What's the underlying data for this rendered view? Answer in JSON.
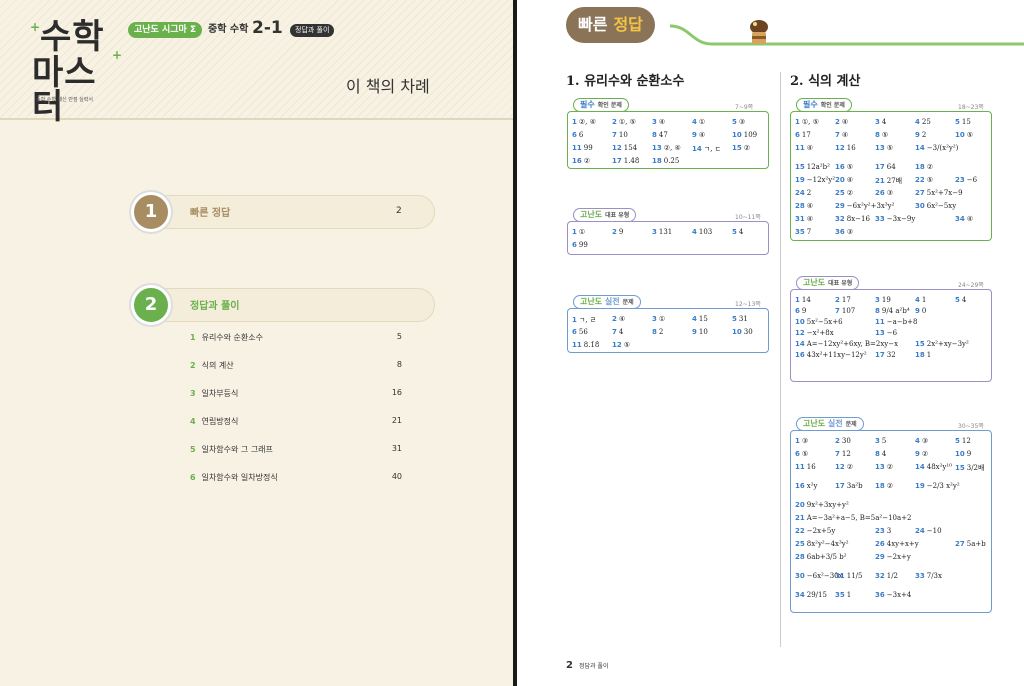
{
  "logo": {
    "line1": "수학",
    "line2": "마스터",
    "sub": "중학 수학 내신 만점 실력서"
  },
  "header": {
    "badge": "고난도 시그마 Σ",
    "subject": "중학 수학",
    "grade": "2-1",
    "tag": "정답과 풀이"
  },
  "toc": {
    "title": "이 책의 차례",
    "sections": [
      {
        "num": "1",
        "label": "빠른 정답",
        "page": "2",
        "color": "#a88c62"
      },
      {
        "num": "2",
        "label": "정답과 풀이",
        "page": "",
        "color": "#6ab04c"
      }
    ],
    "items": [
      {
        "n": "1",
        "t": "유리수와 순환소수",
        "p": "5"
      },
      {
        "n": "2",
        "t": "식의 계산",
        "p": "8"
      },
      {
        "n": "3",
        "t": "일차부등식",
        "p": "16"
      },
      {
        "n": "4",
        "t": "연립방정식",
        "p": "21"
      },
      {
        "n": "5",
        "t": "일차함수와 그 그래프",
        "p": "31"
      },
      {
        "n": "6",
        "t": "일차함수와 일차방정식",
        "p": "40"
      }
    ]
  },
  "quick": {
    "title1": "빠른",
    "title2": "정답"
  },
  "chapters": {
    "c1": "1. 유리수와 순환소수",
    "c2": "2. 식의 계산"
  },
  "footer": {
    "page": "2",
    "text": "정답과 풀이"
  },
  "boxes": [
    {
      "id": "b1",
      "label_a": "필수",
      "label_b": "",
      "label_c": "확인 문제",
      "range": "7~9쪽",
      "answers": [
        [
          "1",
          "②, ④"
        ],
        [
          "2",
          "①, ⑤"
        ],
        [
          "3",
          "④"
        ],
        [
          "4",
          "①"
        ],
        [
          "5",
          "③"
        ],
        [
          "6",
          "6"
        ],
        [
          "7",
          "10"
        ],
        [
          "8",
          "47"
        ],
        [
          "9",
          "④"
        ],
        [
          "10",
          "109"
        ],
        [
          "11",
          "99"
        ],
        [
          "12",
          "154"
        ],
        [
          "13",
          "②, ④"
        ],
        [
          "14",
          "ㄱ, ㄷ"
        ],
        [
          "15",
          "②"
        ],
        [
          "16",
          "②"
        ],
        [
          "17",
          "1.4̇8̇"
        ],
        [
          "18",
          "0.2̇5̇"
        ]
      ]
    },
    {
      "id": "b2",
      "label_a": "고난도",
      "label_b": "",
      "label_c": "대표 유형",
      "range": "10~11쪽",
      "answers": [
        [
          "1",
          "①"
        ],
        [
          "2",
          "9"
        ],
        [
          "3",
          "131"
        ],
        [
          "4",
          "103"
        ],
        [
          "5",
          "4"
        ],
        [
          "6",
          "99"
        ]
      ]
    },
    {
      "id": "b3",
      "label_a": "고난도",
      "label_b": "실전",
      "label_c": "문제",
      "range": "12~13쪽",
      "answers": [
        [
          "1",
          "ㄱ, ㄹ"
        ],
        [
          "2",
          "④"
        ],
        [
          "3",
          "①"
        ],
        [
          "4",
          "15"
        ],
        [
          "5",
          "31"
        ],
        [
          "6",
          "56"
        ],
        [
          "7",
          "4"
        ],
        [
          "8",
          "2"
        ],
        [
          "9",
          "10"
        ],
        [
          "10",
          "30"
        ],
        [
          "11",
          "8.1̇8̇"
        ],
        [
          "12",
          "⑤"
        ]
      ]
    },
    {
      "id": "b4",
      "label_a": "필수",
      "label_b": "",
      "label_c": "확인 문제",
      "range": "18~23쪽",
      "answers": [
        [
          "1",
          "①, ⑤"
        ],
        [
          "2",
          "④"
        ],
        [
          "3",
          "4"
        ],
        [
          "4",
          "25"
        ],
        [
          "5",
          "15"
        ],
        [
          "6",
          "17"
        ],
        [
          "7",
          "④"
        ],
        [
          "8",
          "⑤"
        ],
        [
          "9",
          "2"
        ],
        [
          "10",
          "⑤"
        ],
        [
          "11",
          "④"
        ],
        [
          "12",
          "16"
        ],
        [
          "13",
          "⑤"
        ],
        [
          "14",
          "−3/(x²y²)"
        ],
        [
          "15",
          "12a²b²"
        ],
        [
          "16",
          "⑤"
        ],
        [
          "17",
          "64"
        ],
        [
          "18",
          "②"
        ],
        [
          "19",
          "−12x²y²"
        ],
        [
          "20",
          "④"
        ],
        [
          "21",
          "27배"
        ],
        [
          "22",
          "⑤"
        ],
        [
          "23",
          "−6"
        ],
        [
          "24",
          "2"
        ],
        [
          "25",
          "②"
        ],
        [
          "26",
          "③"
        ],
        [
          "27",
          "5x²+7x−9"
        ],
        [
          "28",
          "④"
        ],
        [
          "29",
          "−6x²y²+3x³y²"
        ],
        [
          "30",
          "6x²−5xy"
        ],
        [
          "31",
          "④"
        ],
        [
          "32",
          "8x−16"
        ],
        [
          "33",
          "−3x−9y"
        ],
        [
          "34",
          "④"
        ],
        [
          "35",
          "7"
        ],
        [
          "36",
          "③"
        ]
      ]
    },
    {
      "id": "b5",
      "label_a": "고난도",
      "label_b": "",
      "label_c": "대표 유형",
      "range": "24~29쪽",
      "answers": [
        [
          "1",
          "14"
        ],
        [
          "2",
          "17"
        ],
        [
          "3",
          "19"
        ],
        [
          "4",
          "1"
        ],
        [
          "5",
          "4"
        ],
        [
          "6",
          "9"
        ],
        [
          "7",
          "107"
        ],
        [
          "8",
          "9/4 a²b⁴"
        ],
        [
          "9",
          "0"
        ],
        [
          "10",
          "5x²−5x+6"
        ],
        [
          "11",
          "−a−b+8"
        ],
        [
          "12",
          "−x²+8x"
        ],
        [
          "13",
          "−6"
        ],
        [
          "14",
          "A=−12xy²+6xy, B=2xy−x"
        ],
        [
          "15",
          "2x²+xy−3y²"
        ],
        [
          "16",
          "43x²+11xy−12y²"
        ],
        [
          "17",
          "32"
        ],
        [
          "18",
          "1"
        ]
      ]
    },
    {
      "id": "b6",
      "label_a": "고난도",
      "label_b": "실전",
      "label_c": "문제",
      "range": "30~35쪽",
      "answers": [
        [
          "1",
          "③"
        ],
        [
          "2",
          "30"
        ],
        [
          "3",
          "5"
        ],
        [
          "4",
          "③"
        ],
        [
          "5",
          "12"
        ],
        [
          "6",
          "⑤"
        ],
        [
          "7",
          "12"
        ],
        [
          "8",
          "4"
        ],
        [
          "9",
          "②"
        ],
        [
          "10",
          "9"
        ],
        [
          "11",
          "16"
        ],
        [
          "12",
          "②"
        ],
        [
          "13",
          "②"
        ],
        [
          "14",
          "48x²y¹⁰"
        ],
        [
          "15",
          "3/2배"
        ],
        [
          "16",
          "x²y"
        ],
        [
          "17",
          "3a²b"
        ],
        [
          "18",
          "②"
        ],
        [
          "19",
          "−2/3 x²y²"
        ],
        [
          "20",
          "9x²+3xy+y²"
        ],
        [
          "21",
          "A=−3a²+a−5, B=5a²−10a+2"
        ],
        [
          "22",
          "−2x+5y"
        ],
        [
          "23",
          "3"
        ],
        [
          "24",
          "−10"
        ],
        [
          "25",
          "8x²y²−4x³y²"
        ],
        [
          "26",
          "4xy+x+y"
        ],
        [
          "27",
          "5a+b"
        ],
        [
          "28",
          "6ab+3/5 b²"
        ],
        [
          "29",
          "−2x+y"
        ],
        [
          "30",
          "−6x²−30x"
        ],
        [
          "31",
          "11/5"
        ],
        [
          "32",
          "1/2"
        ],
        [
          "33",
          "7/3x"
        ],
        [
          "34",
          "29/15"
        ],
        [
          "35",
          "1"
        ],
        [
          "36",
          "−3x+4"
        ]
      ]
    }
  ]
}
